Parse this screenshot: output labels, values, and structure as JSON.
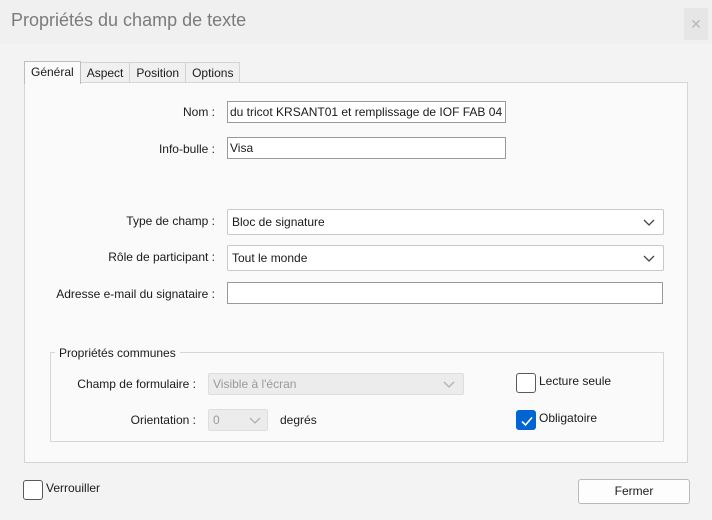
{
  "window": {
    "title": "Propriétés du champ de texte",
    "close_icon": "close-icon"
  },
  "tabs": [
    {
      "label": "Général",
      "active": true
    },
    {
      "label": "Aspect",
      "active": false
    },
    {
      "label": "Position",
      "active": false
    },
    {
      "label": "Options",
      "active": false
    }
  ],
  "general": {
    "name_label": "Nom :",
    "name_value": "du tricot KRSANT01 et remplissage de IOF  FAB 04",
    "tooltip_label": "Info-bulle :",
    "tooltip_value": "Visa",
    "field_type_label": "Type de champ :",
    "field_type_value": "Bloc de signature",
    "participant_role_label": "Rôle de participant :",
    "participant_role_value": "Tout le monde",
    "signer_email_label": "Adresse e-mail du signataire :",
    "signer_email_value": ""
  },
  "common": {
    "group_title": "Propriétés communes",
    "form_field_label": "Champ de formulaire :",
    "form_field_value": "Visible à l'écran",
    "orientation_label": "Orientation :",
    "orientation_value": "0",
    "orientation_unit": "degrés",
    "read_only_label": "Lecture seule",
    "read_only_checked": false,
    "required_label": "Obligatoire",
    "required_checked": true
  },
  "footer": {
    "lock_label": "Verrouiller",
    "lock_checked": false,
    "close_button": "Fermer"
  },
  "colors": {
    "accent": "#0064d2"
  }
}
